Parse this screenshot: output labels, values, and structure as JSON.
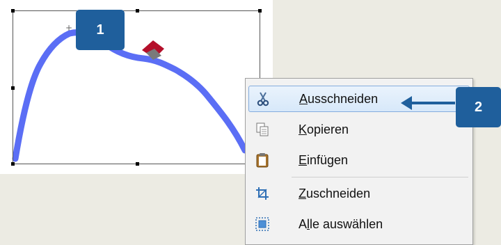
{
  "callouts": {
    "first": "1",
    "second": "2"
  },
  "context_menu": {
    "items": [
      {
        "label": "Ausschneiden",
        "accel": "A",
        "icon": "scissors-icon",
        "highlighted": true
      },
      {
        "label": "Kopieren",
        "accel": "K",
        "icon": "copy-icon",
        "highlighted": false
      },
      {
        "label": "Einfügen",
        "accel": "E",
        "icon": "paste-icon",
        "highlighted": false
      },
      {
        "label": "Zuschneiden",
        "accel": "Z",
        "icon": "crop-icon",
        "highlighted": false
      },
      {
        "label": "Alle auswählen",
        "accel": "l",
        "icon": "select-all-icon",
        "highlighted": false
      }
    ]
  },
  "colors": {
    "callout": "#1f5f9c",
    "stroke": "#5b6ef5",
    "highlight": "#d7e8fa"
  }
}
